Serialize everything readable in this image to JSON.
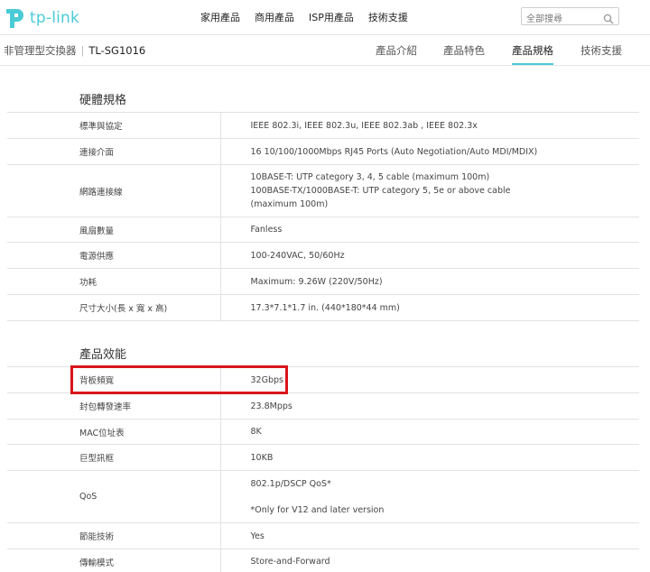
{
  "brand": {
    "logo_text": "tp-link",
    "accent": "#4acbd6",
    "highlight_color": "#d9151c"
  },
  "top_nav": [
    "家用產品",
    "商用產品",
    "ISP用產品",
    "技術支援"
  ],
  "search": {
    "placeholder": "全部搜尋",
    "icon": "search-icon"
  },
  "breadcrumb": {
    "category": "非管理型交換器",
    "model": "TL-SG1016"
  },
  "sub_tabs": [
    {
      "label": "產品介紹",
      "active": false
    },
    {
      "label": "產品特色",
      "active": false
    },
    {
      "label": "產品規格",
      "active": true
    },
    {
      "label": "技術支援",
      "active": false
    }
  ],
  "hardware": {
    "title": "硬體規格",
    "rows": [
      {
        "key": "標準與協定",
        "value": [
          "IEEE 802.3i, IEEE 802.3u, IEEE 802.3ab , IEEE 802.3x"
        ]
      },
      {
        "key": "連接介面",
        "value": [
          "16 10/100/1000Mbps RJ45 Ports (Auto Negotiation/Auto MDI/MDIX)"
        ]
      },
      {
        "key": "網路連接線",
        "value": [
          "10BASE-T: UTP category 3, 4, 5 cable (maximum 100m)",
          "100BASE-TX/1000BASE-T: UTP category 5, 5e or above cable (maximum 100m)"
        ]
      },
      {
        "key": "風扇數量",
        "value": [
          "Fanless"
        ]
      },
      {
        "key": "電源供應",
        "value": [
          "100-240VAC, 50/60Hz"
        ]
      },
      {
        "key": "功耗",
        "value": [
          "Maximum: 9.26W (220V/50Hz)"
        ]
      },
      {
        "key": "尺寸大小(長 x 寬 x 高)",
        "value": [
          "17.3*7.1*1.7 in. (440*180*44 mm)"
        ]
      }
    ]
  },
  "performance": {
    "title": "產品效能",
    "rows": [
      {
        "key": "背板頻寬",
        "value": [
          "32Gbps"
        ]
      },
      {
        "key": "封包轉發速率",
        "value": [
          "23.8Mpps"
        ]
      },
      {
        "key": "MAC位址表",
        "value": [
          "8K"
        ]
      },
      {
        "key": "巨型訊框",
        "value": [
          "10KB"
        ]
      },
      {
        "key": "QoS",
        "value": [
          "802.1p/DSCP QoS*",
          "*Only for V12 and later version"
        ]
      },
      {
        "key": "節能技術",
        "value": [
          "Yes"
        ]
      },
      {
        "key": "傳輸模式",
        "value": [
          "Store-and-Forward"
        ]
      }
    ]
  }
}
